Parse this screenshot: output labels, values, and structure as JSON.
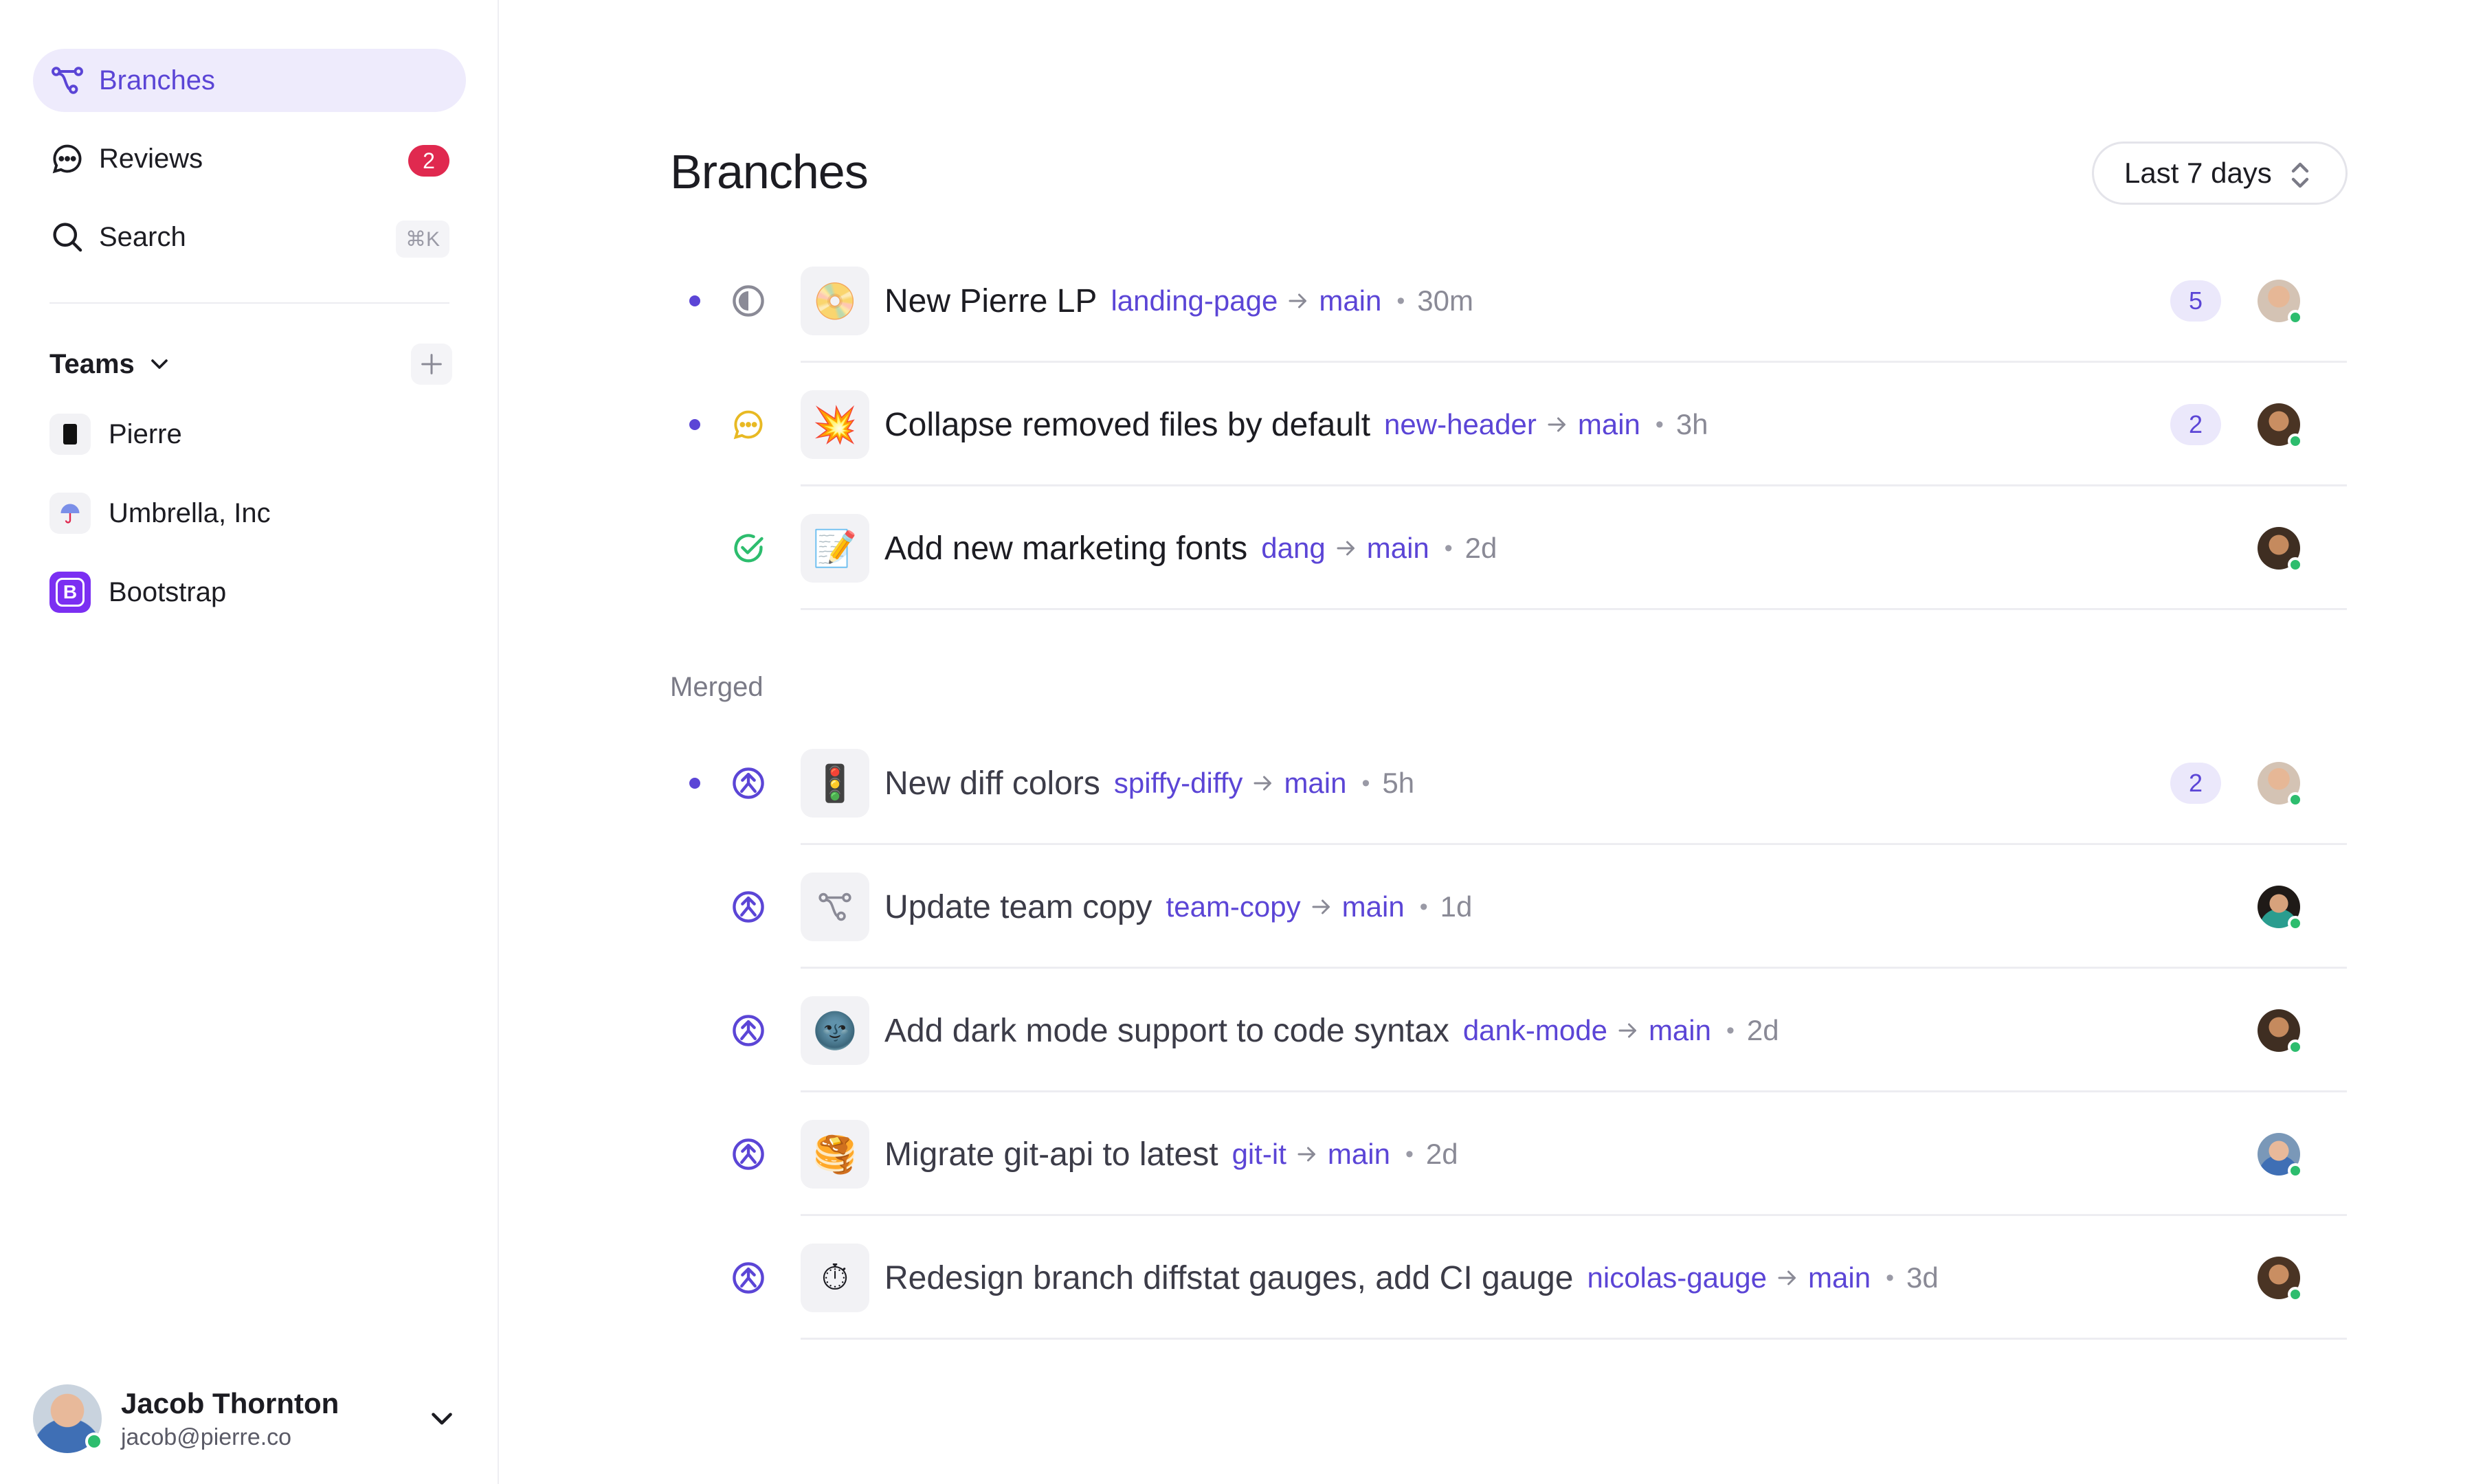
{
  "sidebar": {
    "nav": [
      {
        "label": "Branches",
        "icon": "branches-icon",
        "active": true
      },
      {
        "label": "Reviews",
        "icon": "chat-bubble-icon",
        "badge": "2"
      },
      {
        "label": "Search",
        "icon": "search-icon",
        "shortcut": "⌘K"
      }
    ],
    "teams_label": "Teams",
    "teams": [
      {
        "name": "Pierre",
        "icon": "pierre-logo-icon"
      },
      {
        "name": "Umbrella, Inc",
        "icon": "umbrella-logo-icon"
      },
      {
        "name": "Bootstrap",
        "icon": "bootstrap-logo-icon",
        "logo_letter": "B"
      }
    ],
    "user": {
      "name": "Jacob Thornton",
      "email": "jacob@pierre.co"
    }
  },
  "main": {
    "title": "Branches",
    "range": "Last 7 days",
    "merged_label": "Merged",
    "open_branches": [
      {
        "title": "New Pierre LP",
        "source": "landing-page",
        "target": "main",
        "age": "30m",
        "count": "5",
        "unread": true,
        "status": "in-progress-icon",
        "emoji": "📀"
      },
      {
        "title": "Collapse removed files by default",
        "source": "new-header",
        "target": "main",
        "age": "3h",
        "count": "2",
        "unread": true,
        "status": "comment-icon",
        "emoji": "💥"
      },
      {
        "title": "Add new marketing fonts",
        "source": "dang",
        "target": "main",
        "age": "2d",
        "count": null,
        "unread": false,
        "status": "approved-icon",
        "emoji": "📝"
      }
    ],
    "merged_branches": [
      {
        "title": "New diff colors",
        "source": "spiffy-diffy",
        "target": "main",
        "age": "5h",
        "count": "2",
        "unread": true,
        "status": "merged-icon",
        "emoji": "🚦"
      },
      {
        "title": "Update team copy",
        "source": "team-copy",
        "target": "main",
        "age": "1d",
        "count": null,
        "unread": false,
        "status": "merged-icon",
        "emoji": "branch"
      },
      {
        "title": "Add dark mode support to code syntax",
        "source": "dank-mode",
        "target": "main",
        "age": "2d",
        "count": null,
        "unread": false,
        "status": "merged-icon",
        "emoji": "🌚"
      },
      {
        "title": "Migrate git-api to latest",
        "source": "git-it",
        "target": "main",
        "age": "2d",
        "count": null,
        "unread": false,
        "status": "merged-icon",
        "emoji": "🥞"
      },
      {
        "title": "Redesign branch diffstat gauges, add CI gauge",
        "source": "nicolas-gauge",
        "target": "main",
        "age": "3d",
        "count": null,
        "unread": false,
        "status": "merged-icon",
        "emoji": "⏱"
      }
    ]
  },
  "colors": {
    "accent": "#5b45d6",
    "accent_bg": "#eeebfc",
    "badge_red": "#e0294f",
    "presence_green": "#2dbd6e",
    "approved_green": "#2dbd6e",
    "comment_yellow": "#e8b923"
  }
}
